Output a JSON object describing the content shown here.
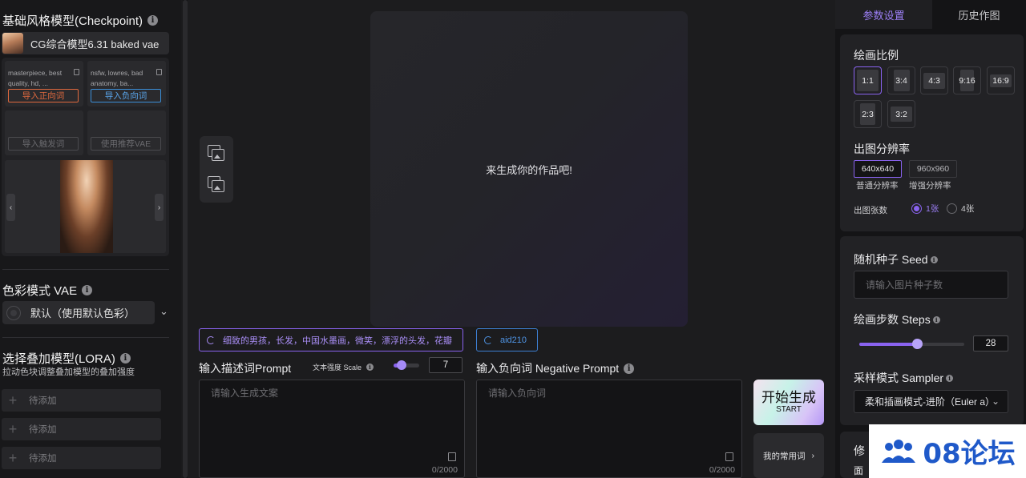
{
  "left": {
    "checkpoint_title": "基础风格模型(Checkpoint)",
    "checkpoint_model": "CG综合模型6.31 baked vae",
    "positive_preview": "masterpiece, best quality, hd, ...",
    "negative_preview": "nsfw, lowres, bad anatomy, ba...",
    "import_positive": "导入正向词",
    "import_negative": "导入负向词",
    "import_trigger": "导入触发词",
    "use_vae": "使用推荐VAE",
    "vae_title": "色彩模式 VAE",
    "vae_value": "默认（使用默认色彩）",
    "lora_title": "选择叠加模型(LORA)",
    "lora_subtitle": "拉动色块调整叠加模型的叠加强度",
    "lora_items": [
      "待添加",
      "待添加",
      "待添加"
    ]
  },
  "center": {
    "canvas_hint": "来生成你的作品吧!",
    "suggest_prompt": "细致的男孩，长发，中国水墨画，微笑，漂浮的头发，花瓣",
    "suggest_negative": "aid210",
    "prompt_label": "输入描述词Prompt",
    "scale_label": "文本强度 Scale",
    "scale_value": "7",
    "scale_fraction": 0.3,
    "negative_label": "输入负向词 Negative Prompt",
    "prompt_placeholder": "请输入生成文案",
    "negative_placeholder": "请输入负向词",
    "prompt_count": "0/2000",
    "negative_count": "0/2000",
    "start_label": "开始生成",
    "start_sub": "START",
    "favorites_label": "我的常用词"
  },
  "right": {
    "tab_params": "参数设置",
    "tab_history": "历史作图",
    "ratio_title": "绘画比例",
    "ratios": [
      "1:1",
      "3:4",
      "4:3",
      "9:16",
      "16:9",
      "2:3",
      "3:2"
    ],
    "ratio_selected": "1:1",
    "resolution_title": "出图分辨率",
    "resolution_normal": "640x640",
    "resolution_high": "960x960",
    "resolution_normal_caption": "普通分辨率",
    "resolution_high_caption": "增强分辨率",
    "count_label": "出图张数",
    "count_one": "1张",
    "count_four": "4张",
    "seed_title": "随机种子 Seed",
    "seed_placeholder": "请输入图片种子数",
    "steps_title": "绘画步数 Steps",
    "steps_value": "28",
    "steps_fraction": 0.55,
    "sampler_title": "采样模式 Sampler",
    "sampler_value": "柔和插画模式-进阶（Euler a）",
    "next_section_title": "修",
    "next_section_sub": "面"
  },
  "watermark": {
    "text": "08论坛"
  },
  "colors": {
    "accent": "#8a63f0",
    "positive": "#e0693e",
    "negative": "#3b8fd9"
  }
}
